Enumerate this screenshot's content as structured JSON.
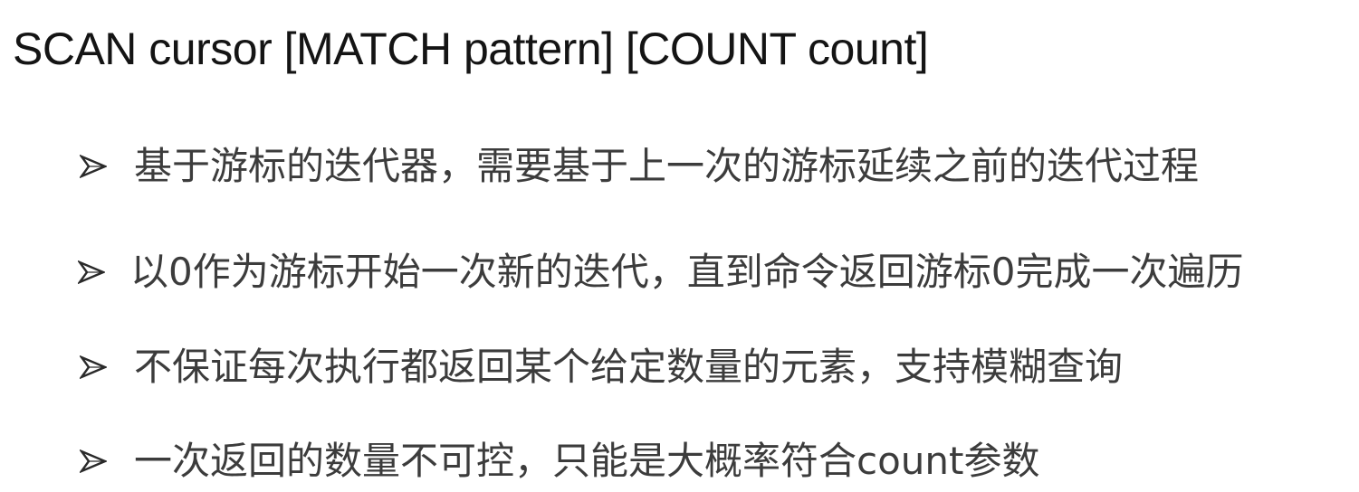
{
  "slide": {
    "title": "SCAN cursor [MATCH pattern] [COUNT count]",
    "bullets": [
      {
        "icon": "arrowhead-bullet-icon",
        "text": "基于游标的迭代器，需要基于上一次的游标延续之前的迭代过程"
      },
      {
        "icon": "arrowhead-bullet-icon",
        "text": "以0作为游标开始一次新的迭代，直到命令返回游标0完成一次遍历"
      },
      {
        "icon": "arrowhead-bullet-icon",
        "text": "不保证每次执行都返回某个给定数量的元素，支持模糊查询"
      },
      {
        "icon": "arrowhead-bullet-icon",
        "text": "一次返回的数量不可控，只能是大概率符合count参数"
      }
    ]
  }
}
